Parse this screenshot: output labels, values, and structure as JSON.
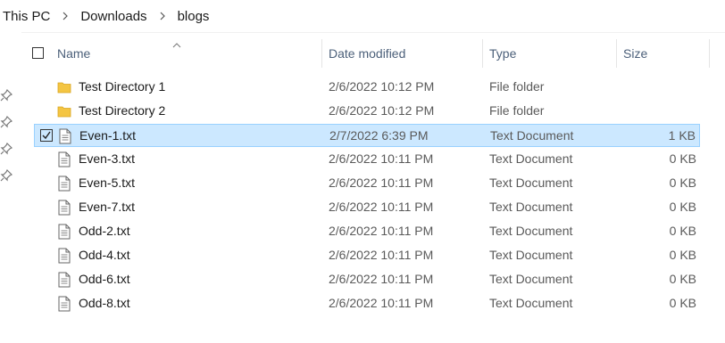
{
  "breadcrumb": {
    "items": [
      "This PC",
      "Downloads",
      "blogs"
    ]
  },
  "columns": {
    "name": "Name",
    "date": "Date modified",
    "type": "Type",
    "size": "Size"
  },
  "files": [
    {
      "name": "Test Directory 1",
      "date": "2/6/2022 10:12 PM",
      "type": "File folder",
      "size": "",
      "icon": "folder-icon",
      "selected": false
    },
    {
      "name": "Test Directory 2",
      "date": "2/6/2022 10:12 PM",
      "type": "File folder",
      "size": "",
      "icon": "folder-icon",
      "selected": false
    },
    {
      "name": "Even-1.txt",
      "date": "2/7/2022 6:39 PM",
      "type": "Text Document",
      "size": "1 KB",
      "icon": "text-file-icon",
      "selected": true
    },
    {
      "name": "Even-3.txt",
      "date": "2/6/2022 10:11 PM",
      "type": "Text Document",
      "size": "0 KB",
      "icon": "text-file-icon",
      "selected": false
    },
    {
      "name": "Even-5.txt",
      "date": "2/6/2022 10:11 PM",
      "type": "Text Document",
      "size": "0 KB",
      "icon": "text-file-icon",
      "selected": false
    },
    {
      "name": "Even-7.txt",
      "date": "2/6/2022 10:11 PM",
      "type": "Text Document",
      "size": "0 KB",
      "icon": "text-file-icon",
      "selected": false
    },
    {
      "name": "Odd-2.txt",
      "date": "2/6/2022 10:11 PM",
      "type": "Text Document",
      "size": "0 KB",
      "icon": "text-file-icon",
      "selected": false
    },
    {
      "name": "Odd-4.txt",
      "date": "2/6/2022 10:11 PM",
      "type": "Text Document",
      "size": "0 KB",
      "icon": "text-file-icon",
      "selected": false
    },
    {
      "name": "Odd-6.txt",
      "date": "2/6/2022 10:11 PM",
      "type": "Text Document",
      "size": "0 KB",
      "icon": "text-file-icon",
      "selected": false
    },
    {
      "name": "Odd-8.txt",
      "date": "2/6/2022 10:11 PM",
      "type": "Text Document",
      "size": "0 KB",
      "icon": "text-file-icon",
      "selected": false
    }
  ],
  "colors": {
    "selection_bg": "#cce8ff",
    "selection_border": "#99d1ff",
    "header_text": "#4c607a",
    "folder": "#f4c542"
  }
}
